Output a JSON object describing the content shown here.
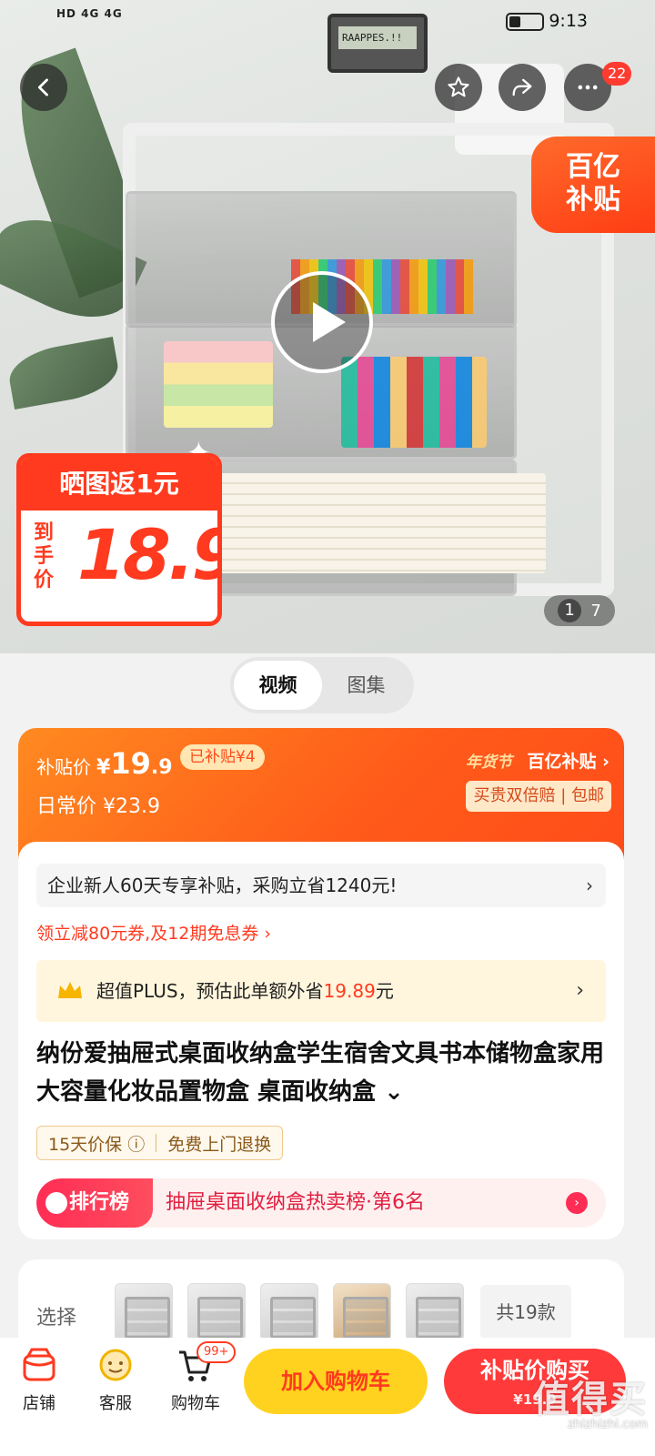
{
  "status_bar": {
    "left": "HD 4G 4G",
    "time": "9:13"
  },
  "hero": {
    "calculator_display": "RAAPPES.!!",
    "badge_count": "22",
    "subsidy_tag_line1": "百亿",
    "subsidy_tag_line2": "补贴",
    "price_card_top": "晒图返1元",
    "price_card_daoshou": "到手价",
    "price_card_price": "18.9",
    "page_current": "1",
    "page_total": "7"
  },
  "media_tabs": [
    "视频",
    "图集"
  ],
  "price_panel": {
    "subsidy_label": "补贴价",
    "yen": "¥",
    "price_int": "19",
    "price_dec": ".9",
    "subsidized": "已补贴¥4",
    "daily_label": "日常价 ¥23.9",
    "brand_year": "年货节",
    "brand": "百亿补贴 ›",
    "promise": "买贵双倍赔 | 包邮"
  },
  "main_card": {
    "enterprise": "企业新人60天专享补贴，采购立省1240元!",
    "coupon": "领立减80元券,及12期免息券 ›",
    "plus_prefix": "超值PLUS，预估此单额外省",
    "plus_amount": "19.89",
    "plus_suffix": "元",
    "title": "纳份爱抽屉式桌面收纳盒学生宿舍文具书本储物盒家用大容量化妆品置物盒 桌面收纳盒 ⌄",
    "guarantee_1": "15天价保 ⓘ",
    "guarantee_2": "免费上门退换",
    "rank_tag": "排行榜",
    "rank_text": "抽屉桌面收纳盒热卖榜·第6名"
  },
  "choose": {
    "label": "选择",
    "total": "共19款"
  },
  "bottom_bar": {
    "shop": "店铺",
    "service": "客服",
    "cart": "购物车",
    "cart_badge": "99+",
    "add_cart": "加入购物车",
    "buy_now": "补贴价购买",
    "buy_now_sub": "¥19.9"
  },
  "watermark": {
    "text": "值得买",
    "url": "zhizhizhi.com"
  },
  "colors": {
    "accent": "#ff3a1f",
    "orange": "#ff6a1a",
    "cart_yellow": "#ffd21f"
  }
}
